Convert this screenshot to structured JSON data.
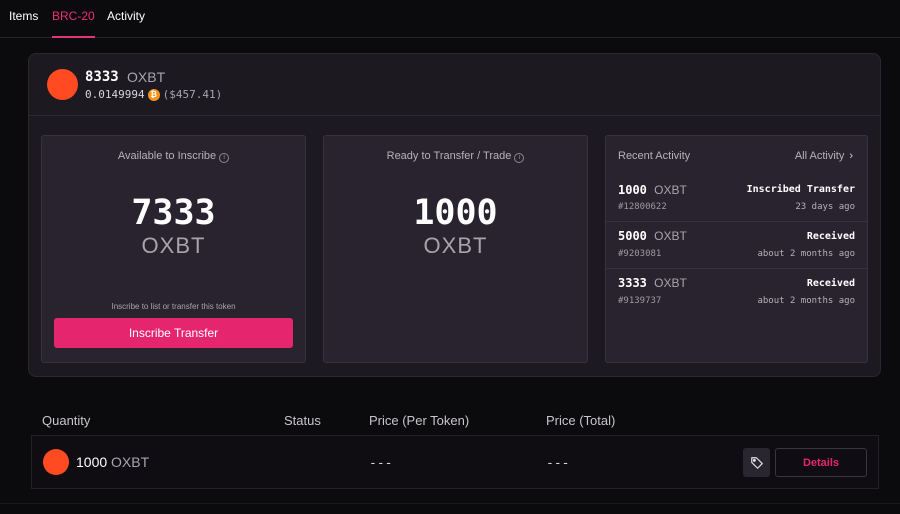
{
  "tabs": [
    {
      "label": "Items"
    },
    {
      "label": "BRC-20"
    },
    {
      "label": "Activity"
    }
  ],
  "token": {
    "amount": "8333",
    "ticker": "OXBT",
    "btc_value": "0.0149994",
    "usd_value": "($457.41)",
    "btc_symbol": "₿"
  },
  "available": {
    "title": "Available to Inscribe",
    "amount": "7333",
    "ticker": "OXBT",
    "hint": "Inscribe to list or transfer this token",
    "button_label": "Inscribe Transfer"
  },
  "ready": {
    "title": "Ready to Transfer / Trade",
    "amount": "1000",
    "ticker": "OXBT"
  },
  "recent_activity": {
    "title": "Recent Activity",
    "all_label": "All Activity",
    "items": [
      {
        "amount": "1000",
        "ticker": "OXBT",
        "type": "Inscribed Transfer",
        "id": "#12800622",
        "time": "23 days ago"
      },
      {
        "amount": "5000",
        "ticker": "OXBT",
        "type": "Received",
        "id": "#9203081",
        "time": "about 2 months ago"
      },
      {
        "amount": "3333",
        "ticker": "OXBT",
        "type": "Received",
        "id": "#9139737",
        "time": "about 2 months ago"
      }
    ]
  },
  "table": {
    "headers": [
      "Quantity",
      "Status",
      "Price (Per Token)",
      "Price (Total)"
    ],
    "rows": [
      {
        "quantity": "1000",
        "ticker": "OXBT",
        "status": "",
        "price_per_token": "---",
        "price_total": "---",
        "details_label": "Details"
      }
    ]
  },
  "colors": {
    "accent": "#e5266f",
    "token_logo": "#ff4a22",
    "btc": "#f7931a"
  },
  "icons": {
    "info": "info-circle-icon",
    "chevron": "chevron-right-icon",
    "tag": "tag-icon",
    "btc": "bitcoin-icon"
  }
}
